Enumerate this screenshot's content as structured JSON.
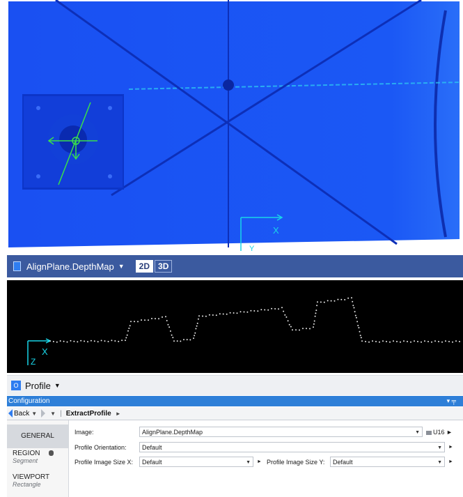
{
  "viewer": {
    "layer_name": "AlignPlane.DepthMap",
    "btn_2d": "2D",
    "btn_3d": "3D",
    "axis_x": "X",
    "axis_y": "Y"
  },
  "profile_view": {
    "axis_x": "X",
    "axis_z": "Z"
  },
  "profile_selector": {
    "icon_letter": "O",
    "label": "Profile"
  },
  "config": {
    "header_title": "Configuration",
    "header_controls": "▾ ╤",
    "back_label": "Back",
    "breadcrumb": "ExtractProfile",
    "tabs": [
      {
        "label": "GENERAL",
        "sub": ""
      },
      {
        "label": "REGION",
        "sub": "Segment"
      },
      {
        "label": "VIEWPORT",
        "sub": "Rectangle"
      }
    ],
    "fields": {
      "image_label": "Image:",
      "image_value": "AlignPlane.DepthMap",
      "image_format": "U16",
      "orientation_label": "Profile Orientation:",
      "orientation_value": "Default",
      "size_x_label": "Profile Image Size X:",
      "size_x_value": "Default",
      "size_y_label": "Profile Image Size Y:",
      "size_y_value": "Default"
    }
  },
  "colors": {
    "depth_blue": "#1a4ff0",
    "toolbar_bg": "#3b5a9f",
    "config_header": "#2e7fd8",
    "axis_cyan": "#19d6e8",
    "marker_green": "#39e04a"
  }
}
